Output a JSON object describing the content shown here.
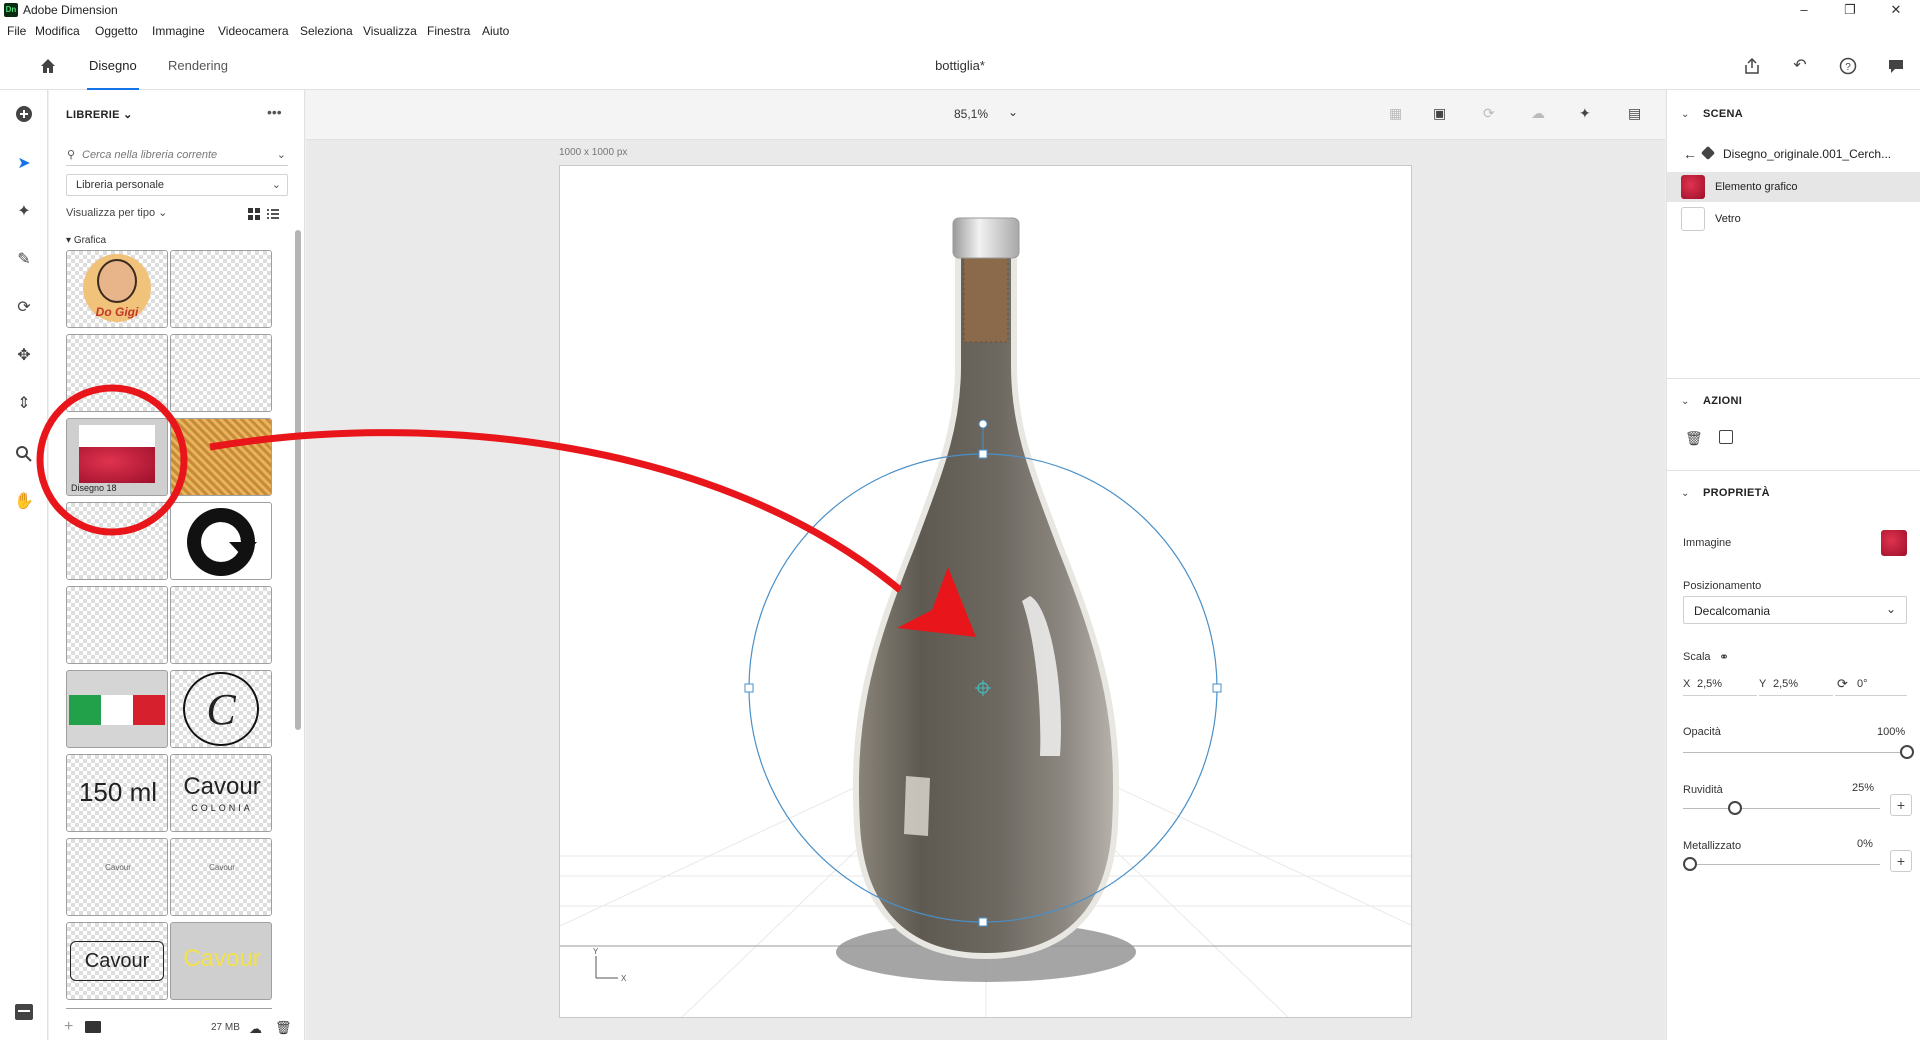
{
  "window": {
    "app_icon": "Dn",
    "title": "Adobe Dimension",
    "controls": [
      "minimize-icon",
      "restore-icon",
      "close-icon"
    ]
  },
  "menu": [
    "File",
    "Modifica",
    "Oggetto",
    "Immagine",
    "Videocamera",
    "Seleziona",
    "Visualizza",
    "Finestra",
    "Aiuto"
  ],
  "header": {
    "tabs": [
      "Disegno",
      "Rendering"
    ],
    "active_tab": "Disegno",
    "doc_title": "bottiglia*"
  },
  "tools": [
    "add-icon",
    "select-icon",
    "magic-wand-icon",
    "sample-icon",
    "orbit-icon",
    "pan-icon",
    "dolly-icon",
    "zoom-icon",
    "hand-icon"
  ],
  "libraries": {
    "header": "LIBRERIE",
    "search_placeholder": "Cerca nella libreria corrente",
    "library_select": "Libreria personale",
    "view_by": "Visualizza per tipo",
    "group": "Grafica",
    "items": [
      "Do Gigi",
      "",
      "",
      "",
      "Disegno 18",
      "",
      "",
      "",
      "",
      "",
      "",
      "",
      "150 ml",
      "Cavour",
      "Cavour",
      "Cavour",
      "Cavour",
      "Cavour"
    ],
    "cavour_sub": "COLONIA",
    "storage": "27 MB"
  },
  "canvas": {
    "zoom": "85,1%",
    "size_label": "1000 x 1000 px",
    "axis_y": "Y",
    "axis_x": "X"
  },
  "scene": {
    "header": "SCENA",
    "path": "Disegno_originale.001_Cerch...",
    "layers": [
      "Elemento grafico",
      "Vetro"
    ]
  },
  "actions": {
    "header": "AZIONI"
  },
  "properties": {
    "header": "PROPRIETÀ",
    "image_label": "Immagine",
    "positioning_label": "Posizionamento",
    "positioning_value": "Decalcomania",
    "scale_label": "Scala",
    "scale_x_label": "X",
    "scale_x": "2,5%",
    "scale_y_label": "Y",
    "scale_y": "2,5%",
    "rotation": "0°",
    "opacity_label": "Opacità",
    "opacity": "100%",
    "opacity_level": 1.0,
    "roughness_label": "Ruvidità",
    "roughness": "25%",
    "roughness_level": 0.25,
    "metallic_label": "Metallizzato",
    "metallic": "0%",
    "metallic_level": 0.0
  },
  "colors": {
    "accent": "#1473e6",
    "annotation": "#e8161a",
    "selection": "#4a90c8"
  }
}
